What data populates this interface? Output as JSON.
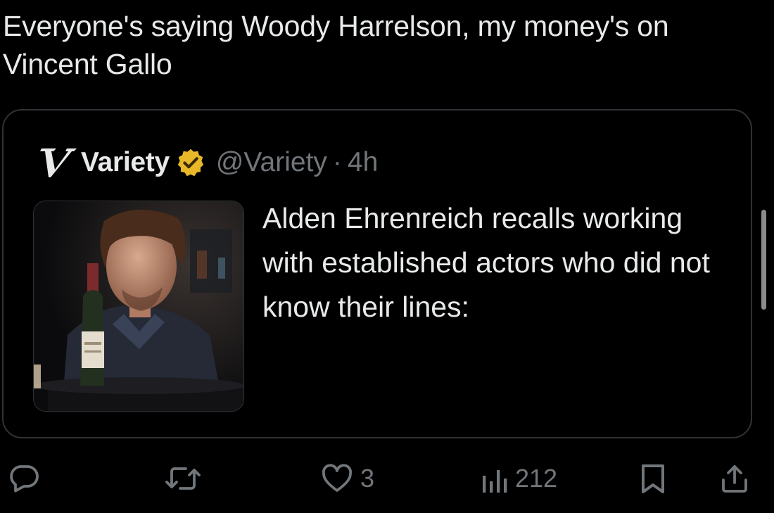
{
  "tweet": {
    "text": "Everyone's saying Woody Harrelson, my money's on Vincent Gallo"
  },
  "quoted_tweet": {
    "author_name": "Variety",
    "handle": "@Variety",
    "separator": "·",
    "time": "4h",
    "text": "Alden Ehrenreich recalls working with established actors who did not know their lines:",
    "logo_icon": "variety-v-logo-icon",
    "verified_icon": "gold-verified-badge-icon",
    "verified_color": "#e8b829"
  },
  "actions": {
    "reply_icon": "reply-icon",
    "retweet_icon": "retweet-icon",
    "like_icon": "heart-icon",
    "like_count": "3",
    "views_icon": "views-bar-chart-icon",
    "views_count": "212",
    "bookmark_icon": "bookmark-icon",
    "share_icon": "share-icon"
  },
  "colors": {
    "background": "#000000",
    "text_primary": "#e7e9ea",
    "text_secondary": "#71767b",
    "border": "#2f3336"
  }
}
